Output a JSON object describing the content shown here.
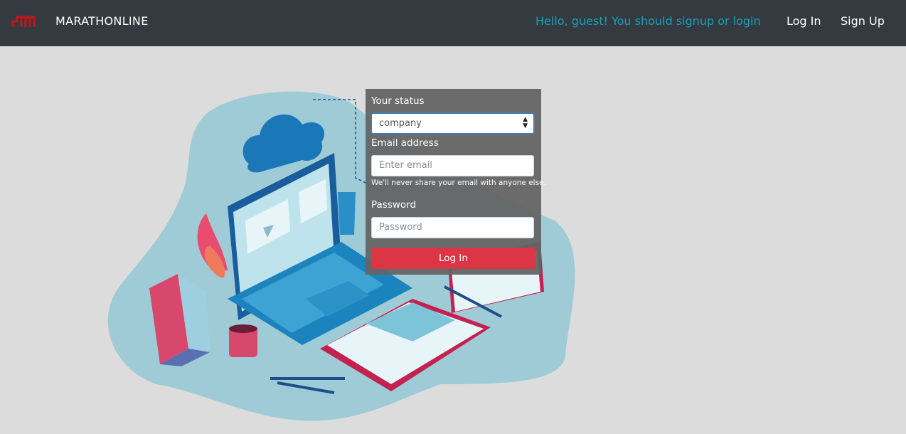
{
  "navbar": {
    "brand": "MARATHONLINE",
    "logo_icon": "marathon-logo-icon",
    "greeting": "Hello, guest! You should signup or login",
    "login_link": "Log In",
    "signup_link": "Sign Up"
  },
  "form": {
    "status_label": "Your status",
    "status_value": "company",
    "email_label": "Email address",
    "email_placeholder": "Enter email",
    "email_help": "We'll never share your email with anyone else.",
    "password_label": "Password",
    "password_placeholder": "Password",
    "submit_label": "Log In"
  },
  "colors": {
    "navbar_bg": "#343a40",
    "greeting": "#17a2b8",
    "button": "#dc3545",
    "logo": "#c4151c",
    "page_bg": "#dcdcdc"
  }
}
